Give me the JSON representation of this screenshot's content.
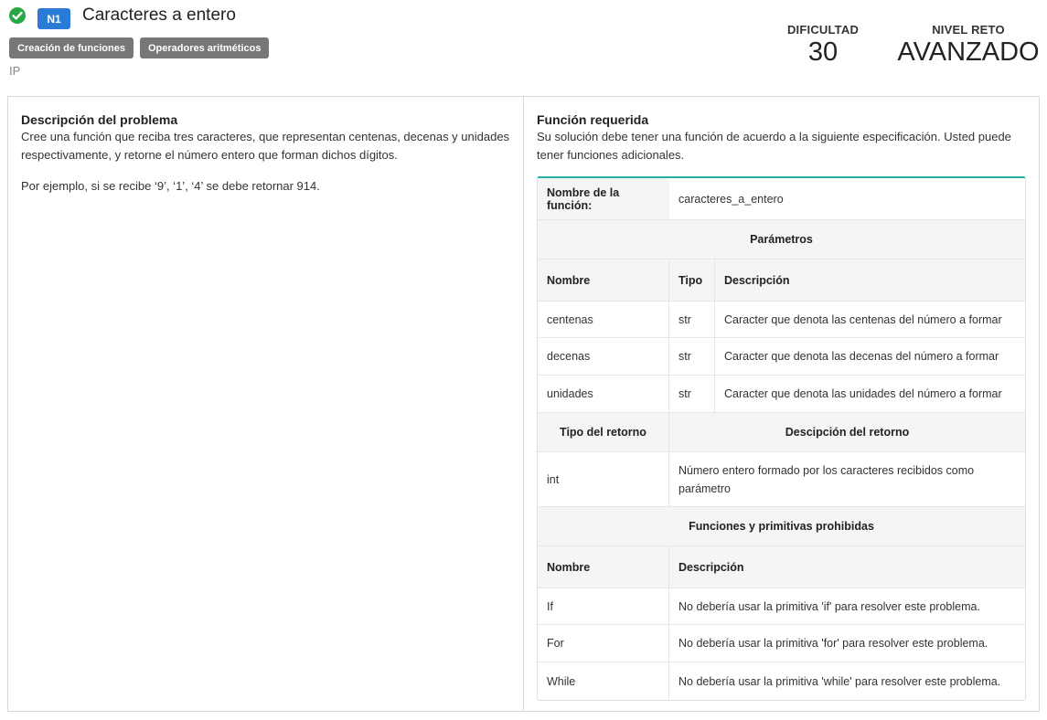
{
  "header": {
    "level_badge": "N1",
    "title": "Caracteres a entero",
    "tags": [
      "Creación de funciones",
      "Operadores aritméticos"
    ],
    "course": "IP",
    "difficulty_label": "DIFICULTAD",
    "difficulty_value": "30",
    "level_label": "NIVEL RETO",
    "level_value": "AVANZADO",
    "status_icon": "check-circle-icon",
    "colors": {
      "success": "#28a745",
      "badge": "#2a7bd8",
      "accent": "#20b2aa"
    }
  },
  "description": {
    "title": "Descripción del problema",
    "paragraphs": [
      "Cree una función que reciba tres caracteres, que representan centenas, decenas y unidades respectivamente, y retorne el número entero que forman dichos dígitos.",
      "Por ejemplo, si se recibe ‘9’, ‘1’, ‘4’ se debe retornar 914."
    ]
  },
  "function_spec": {
    "title": "Función requerida",
    "intro": "Su solución debe tener una función de acuerdo a la siguiente especificación. Usted puede tener funciones adicionales.",
    "name_label": "Nombre de la función:",
    "name_value": "caracteres_a_entero",
    "params_title": "Parámetros",
    "params_headers": [
      "Nombre",
      "Tipo",
      "Descripción"
    ],
    "params": [
      {
        "name": "centenas",
        "type": "str",
        "desc": "Caracter que denota las centenas del número a formar"
      },
      {
        "name": "decenas",
        "type": "str",
        "desc": "Caracter que denota las decenas del número a formar"
      },
      {
        "name": "unidades",
        "type": "str",
        "desc": "Caracter que denota las unidades del número a formar"
      }
    ],
    "return_type_header": "Tipo del retorno",
    "return_desc_header": "Descipción del retorno",
    "return_type": "int",
    "return_desc": "Número entero formado por los caracteres recibidos como parámetro",
    "prohibited_title": "Funciones y primitivas prohibidas",
    "prohibited_headers": [
      "Nombre",
      "Descripción"
    ],
    "prohibited": [
      {
        "name": "If",
        "desc": "No debería usar la primitiva 'if' para resolver este problema."
      },
      {
        "name": "For",
        "desc": "No debería usar la primitiva 'for' para resolver este problema."
      },
      {
        "name": "While",
        "desc": "No debería usar la primitiva 'while' para resolver este problema."
      }
    ]
  }
}
